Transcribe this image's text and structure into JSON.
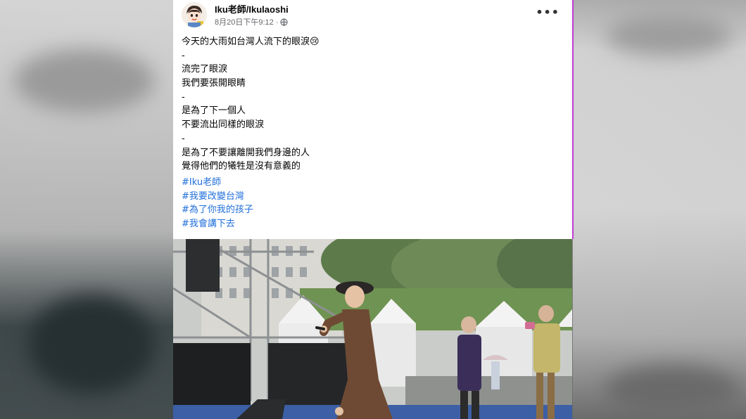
{
  "post": {
    "author": "Iku老師/Ikulaoshi",
    "timestamp": "8月20日下午9:12 ·",
    "privacy_icon": "globe-icon",
    "more_icon": "more-options-icon",
    "more_label": "•••",
    "lines": [
      "今天的大雨如台灣人流下的眼淚😢",
      "-",
      "流完了眼淚",
      "我們要張開眼睛",
      "-",
      "是為了下一個人",
      "不要流出同樣的眼淚",
      "-",
      "是為了不要讓離開我們身邊的人",
      "覺得他們的犧牲是沒有意義的"
    ],
    "hashtags": [
      "#Iku老師",
      "#我要改變台灣",
      "#為了你我的孩子",
      "#我會講下去"
    ]
  },
  "colors": {
    "hashtag": "#216fdb",
    "meta_text": "#65676b",
    "accent_border": "#c23bd4"
  }
}
